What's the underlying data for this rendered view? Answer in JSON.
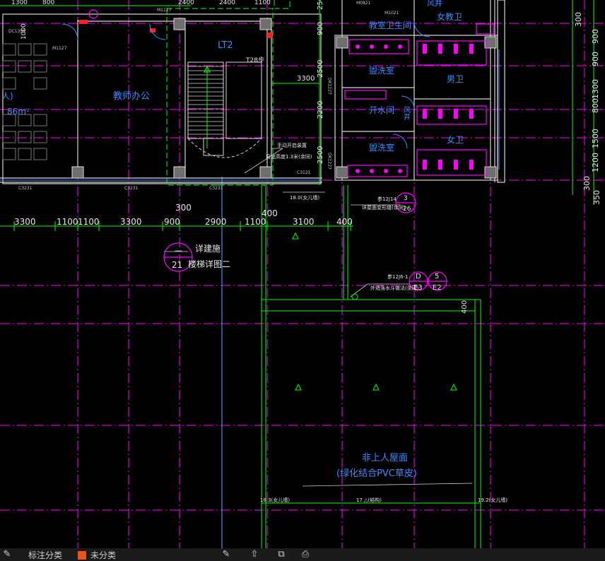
{
  "colors": {
    "background": "#000000",
    "grid_magenta": "#ff00ff",
    "wall_white": "#ffffff",
    "dim_green": "#00ff00",
    "text_blue": "#3c8cff",
    "axis_blue": "#62a6ff",
    "yellow_bubble": "#ffff00"
  },
  "rooms": {
    "teacher_office": "教师办公",
    "stair": "LT2",
    "stair_note": "T28步",
    "class_toilet": "教室卫生间",
    "female_toilet_top": "女教卫",
    "wash_room_1": "盥洗室",
    "male_toilet": "男卫",
    "boil_water": "开水间",
    "wash_room_2": "盥洗室",
    "female_toilet": "女卫",
    "shaft_1": "风井",
    "shaft_2": "风井",
    "left_room_cut": "人)",
    "left_area_cut": "86m²"
  },
  "roof": {
    "title": "非上人屋面",
    "subtitle": "(绿化结合PVC草皮)"
  },
  "door_tags": {
    "m1127_a": "M1127",
    "m1127_b": "M1127",
    "m1021": "M1021",
    "dk1227": "DK1227",
    "dk1227_b": "DK1227",
    "m0821": "M0821",
    "dc1309": "DC1309",
    "c3231_a": "C3231",
    "c3231_b": "C3231",
    "c3231_c": "C3231",
    "c3121": "C3121"
  },
  "dims_bottom": [
    "3300",
    "1100",
    "1100",
    "3300",
    "900",
    "2900",
    "1100",
    "3100",
    "400"
  ],
  "dims_bottom_upper": [
    "300",
    "400"
  ],
  "dims_right": [
    "300",
    "900",
    "900",
    "1300",
    "800",
    "1500",
    "1200",
    "300",
    "350"
  ],
  "dims_inner": [
    "3300",
    "2200",
    "2500",
    "900",
    "2500",
    "2500"
  ],
  "dims_top": [
    "1300",
    "800",
    "2400",
    "2400",
    "1100"
  ],
  "labels": {
    "detail_ref_title": "详建施",
    "detail_ref_desc": "楼梯详图二",
    "detail_ref_num": "21",
    "detail_ref_dash": "—",
    "handrail_note": "手动开启装置",
    "window_note": "窗底高度1.3米(余同)",
    "level_18": "18.0(女儿墙)",
    "ref_j14": "参12J14",
    "ref_j14_sub": "详屋面变形缝(余同)",
    "bubble_3": "3",
    "bubble_3_sub": "26",
    "ref_j6": "参12J6-1",
    "ref_j6_sub": "外墙落水斗做法(余同)",
    "bubble_d": "D",
    "bubble_d_sub": "E3",
    "bubble_5": "5",
    "bubble_5_sub": "E2",
    "dim_400_v": "400",
    "level_18_3": "18.3(女儿墙)",
    "level_17_a": "17.△(结构)",
    "level_19_2": "19.2(女儿墙)",
    "dim_1000": "1000",
    "dim_3300_v": "3300"
  },
  "bottom_bar": {
    "tab1": "标注分类",
    "tab2": "未分类",
    "icons": [
      "pen-icon",
      "upload-icon",
      "copy-icon",
      "print-icon"
    ]
  }
}
